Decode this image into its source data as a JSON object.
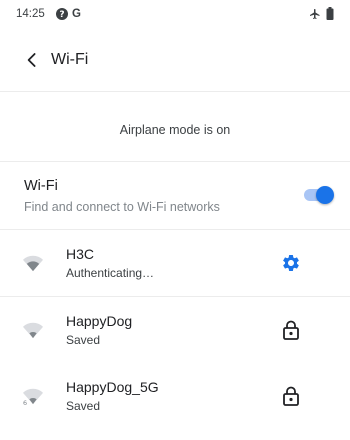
{
  "status_bar": {
    "time": "14:25",
    "g_letter": "G",
    "icons": [
      "help-circle-icon",
      "google-g-icon",
      "airplane-icon",
      "battery-icon"
    ]
  },
  "header": {
    "title": "Wi-Fi"
  },
  "banner": {
    "text": "Airplane mode is on"
  },
  "wifi_toggle": {
    "title": "Wi-Fi",
    "subtitle": "Find and connect to Wi-Fi networks",
    "enabled": true
  },
  "networks": [
    {
      "name": "H3C",
      "status": "Authenticating…",
      "action_icon": "gear-icon",
      "signal": 2,
      "band_label": ""
    },
    {
      "name": "HappyDog",
      "status": "Saved",
      "action_icon": "lock-icon",
      "signal": 1,
      "band_label": ""
    },
    {
      "name": "HappyDog_5G",
      "status": "Saved",
      "action_icon": "lock-icon",
      "signal": 1,
      "band_label": "6"
    }
  ],
  "colors": {
    "accent": "#1a73e8",
    "accent_light": "#a9c5f5",
    "text_primary": "#202124",
    "text_secondary": "#80868b",
    "divider": "#ececec"
  }
}
